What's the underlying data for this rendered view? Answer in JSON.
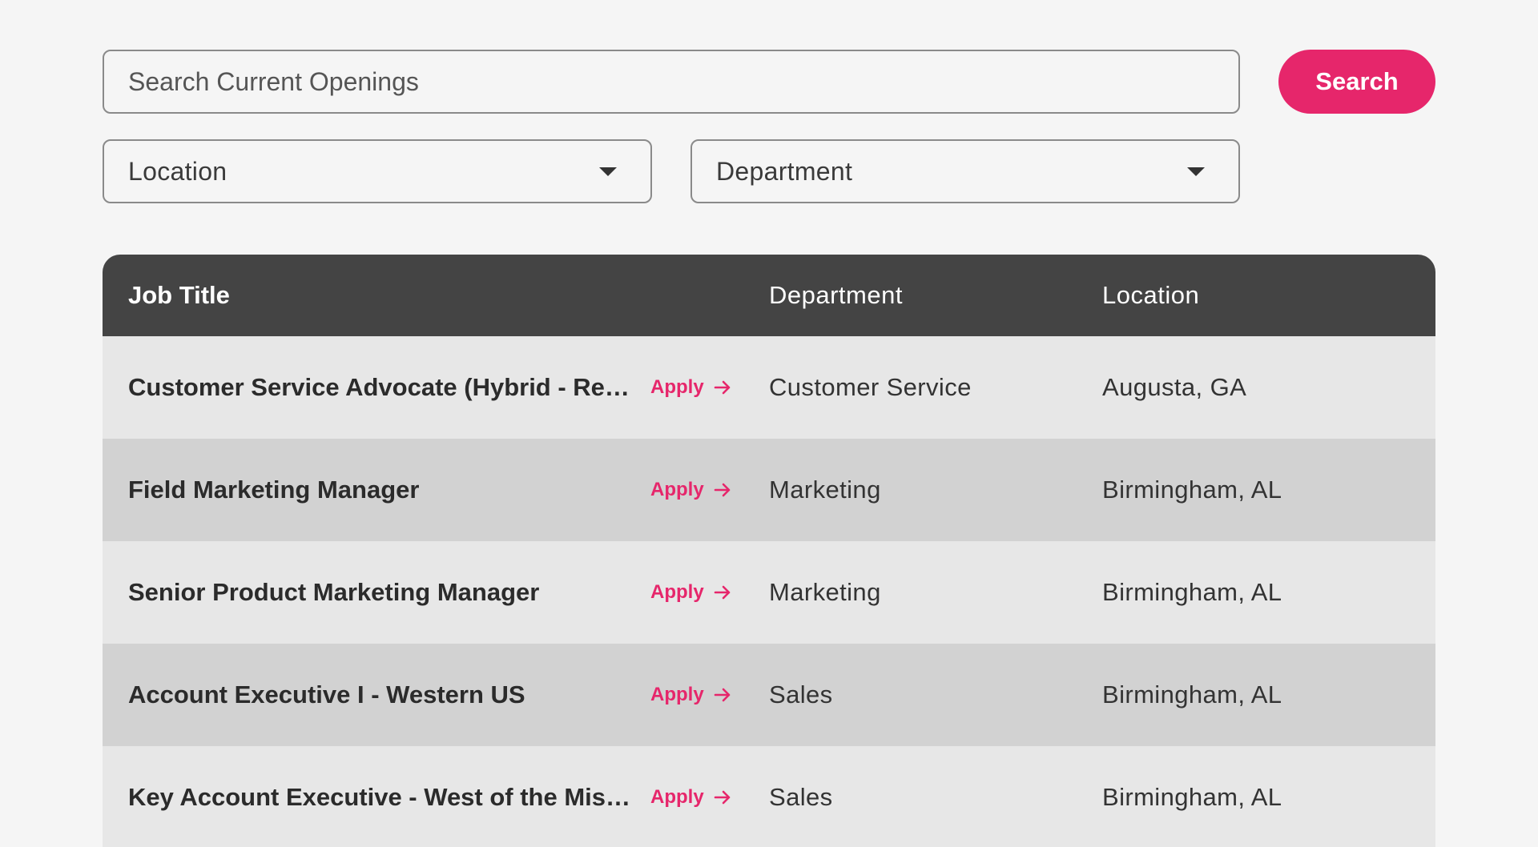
{
  "search": {
    "placeholder": "Search Current Openings",
    "button_label": "Search"
  },
  "filters": {
    "location_label": "Location",
    "department_label": "Department"
  },
  "table": {
    "headers": {
      "job_title": "Job Title",
      "department": "Department",
      "location": "Location"
    },
    "apply_label": "Apply",
    "rows": [
      {
        "title": "Customer Service Advocate (Hybrid - Remot...",
        "department": "Customer Service",
        "location": "Augusta, GA"
      },
      {
        "title": "Field Marketing Manager",
        "department": "Marketing",
        "location": "Birmingham, AL"
      },
      {
        "title": "Senior Product Marketing Manager",
        "department": "Marketing",
        "location": "Birmingham, AL"
      },
      {
        "title": "Account Executive I - Western US",
        "department": "Sales",
        "location": "Birmingham, AL"
      },
      {
        "title": "Key Account Executive - West of the Mississ...",
        "department": "Sales",
        "location": "Birmingham, AL"
      }
    ]
  },
  "colors": {
    "accent": "#e6266b",
    "header_bg": "#444444",
    "row_light": "#e7e7e7",
    "row_dark": "#d2d2d2",
    "page_bg": "#f5f5f5"
  },
  "icons": {
    "apply_icon": "arrow-right-icon",
    "select_icon": "caret-down-icon"
  }
}
